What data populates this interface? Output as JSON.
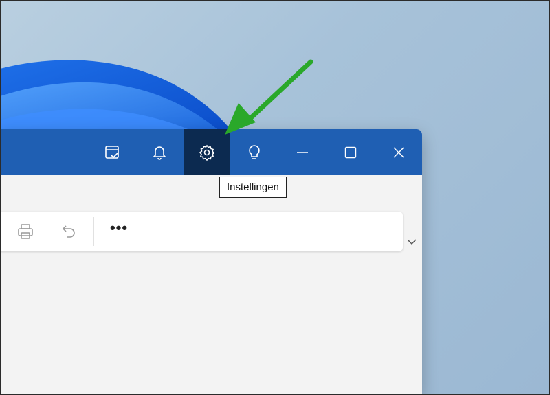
{
  "titlebar": {
    "buttons": [
      {
        "name": "tasks-button",
        "icon": "calendar-check-icon"
      },
      {
        "name": "notifications-button",
        "icon": "bell-icon"
      },
      {
        "name": "settings-button",
        "icon": "gear-icon",
        "active": true
      },
      {
        "name": "tips-button",
        "icon": "lightbulb-icon"
      },
      {
        "name": "minimize-button",
        "icon": "minimize-icon"
      },
      {
        "name": "maximize-button",
        "icon": "maximize-icon"
      },
      {
        "name": "close-button",
        "icon": "close-icon"
      }
    ]
  },
  "tooltip": {
    "text": "Instellingen"
  },
  "toolbar": {
    "items": [
      {
        "name": "print-button",
        "icon": "printer-icon"
      },
      {
        "name": "undo-button",
        "icon": "undo-icon"
      },
      {
        "name": "more-button",
        "icon": "more-icon",
        "label": "•••"
      }
    ]
  },
  "colors": {
    "titlebar": "#1f5fb3",
    "active_button": "#0c2a50",
    "annotation_arrow": "#2aa82a",
    "window_body": "#f3f3f3"
  }
}
